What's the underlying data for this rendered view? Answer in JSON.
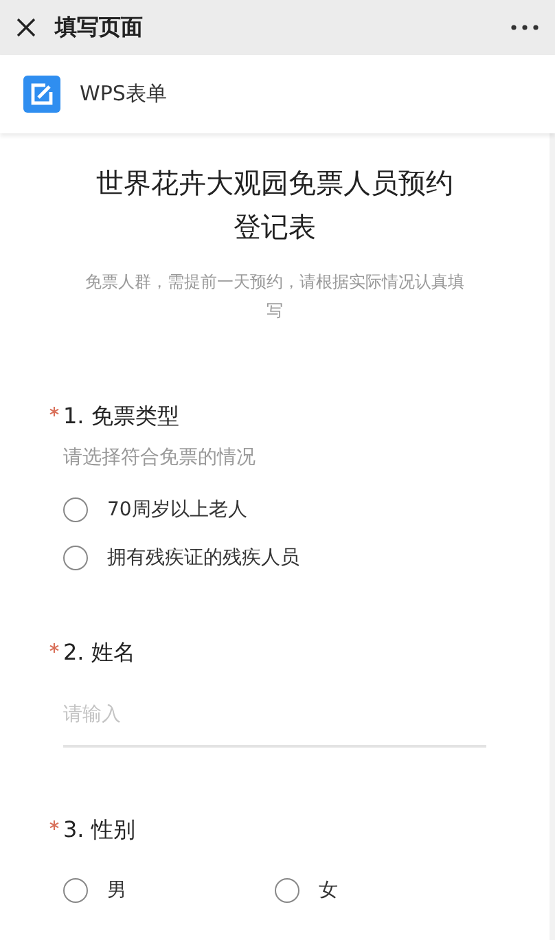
{
  "window": {
    "title": "填写页面"
  },
  "brand": {
    "name": "WPS表单"
  },
  "form": {
    "title": "世界花卉大观园免票人员预约登记表",
    "description": "免票人群，需提前一天预约，请根据实际情况认真填写"
  },
  "questions": [
    {
      "kind": "choice",
      "required": true,
      "label": "1. 免票类型",
      "hint": "请选择符合免票的情况",
      "options": [
        {
          "label": "70周岁以上老人",
          "selected": false
        },
        {
          "label": "拥有残疾证的残疾人员",
          "selected": false
        }
      ]
    },
    {
      "kind": "text",
      "required": true,
      "label": "2. 姓名",
      "placeholder": "请输入"
    },
    {
      "kind": "choice_row",
      "required": true,
      "label": "3. 性别",
      "options": [
        {
          "label": "男",
          "selected": false
        },
        {
          "label": "女",
          "selected": false
        }
      ]
    }
  ]
}
